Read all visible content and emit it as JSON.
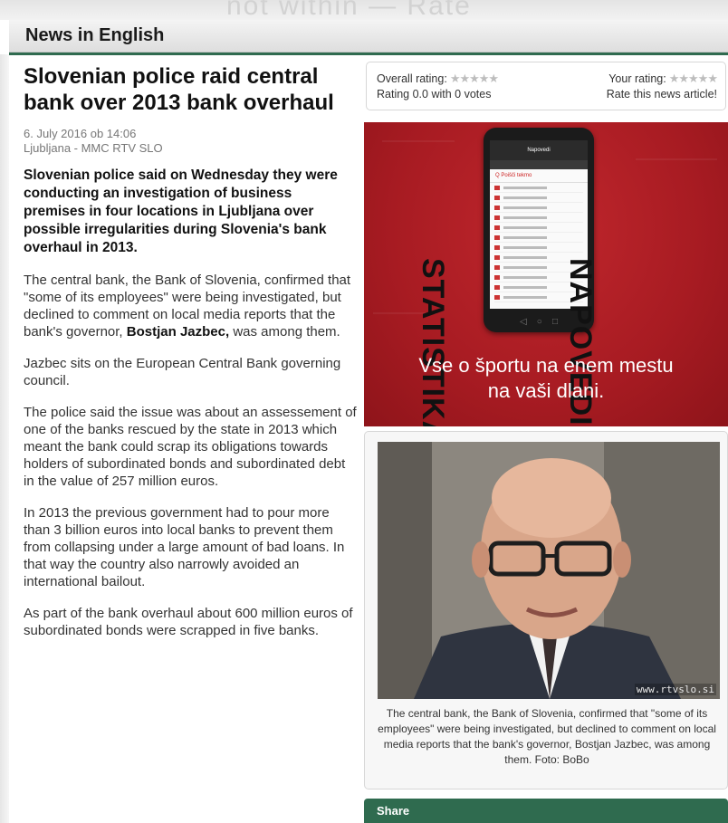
{
  "section": {
    "title": "News in English"
  },
  "background": {
    "watermark": "not within — Rate"
  },
  "article": {
    "headline": "Slovenian police raid central bank over 2013 bank overhaul",
    "date": "6. July 2016 ob 14:06",
    "byline": "Ljubljana - MMC RTV SLO",
    "lead": "Slovenian police said on Wednesday they were conducting an investigation of business premises in four locations in Ljubljana over possible irregularities during Slovenia's bank overhaul in 2013.",
    "p1_before": "The central bank, the Bank of Slovenia, confirmed that \"some of its employees\" were being investigated, but declined to comment on local media reports that the bank's governor,",
    "p1_bold": "Bostjan Jazbec,",
    "p1_after": "was among them.",
    "p2": "Jazbec sits on the European Central Bank governing council.",
    "p3": "The police said the issue was about an assessement of one of the banks rescued by the state in 2013 which meant the bank could scrap its obligations towards holders of subordinated bonds and subordinated debt in the value of 257 million euros.",
    "p4": "In 2013 the previous government had to pour more than 3 billion euros into local banks to prevent them from collapsing under a large amount of bad loans. In that way the country also narrowly avoided an international bailout.",
    "p5": "As part of the bank overhaul about 600 million euros of subordinated bonds were scrapped in five banks."
  },
  "rating": {
    "overall_label": "Overall rating:",
    "overall_summary": "Rating 0.0 with 0 votes",
    "your_label": "Your rating:",
    "rate_prompt": "Rate this news article!",
    "stars": "★★★★★",
    "star_color": "#bdbdbd"
  },
  "ad": {
    "word_left": "STATISTIKA",
    "word_right": "NAPOVEDI",
    "tagline_line1": "Vse o športu na enem mestu",
    "tagline_line2": "na vaši dlani.",
    "phone_app_title": "Napovedi",
    "phone_search": "Q  Poišči tekmo",
    "background_color": "#a71b22"
  },
  "photo": {
    "credit": "www.rtvslo.si",
    "caption": "The central bank, the Bank of Slovenia, confirmed that \"some of its employees\" were being investigated, but declined to comment on local media reports that the bank's governor, Bostjan Jazbec, was among them. Foto: BoBo"
  },
  "share": {
    "label": "Share",
    "color": "#2f6b4f"
  }
}
